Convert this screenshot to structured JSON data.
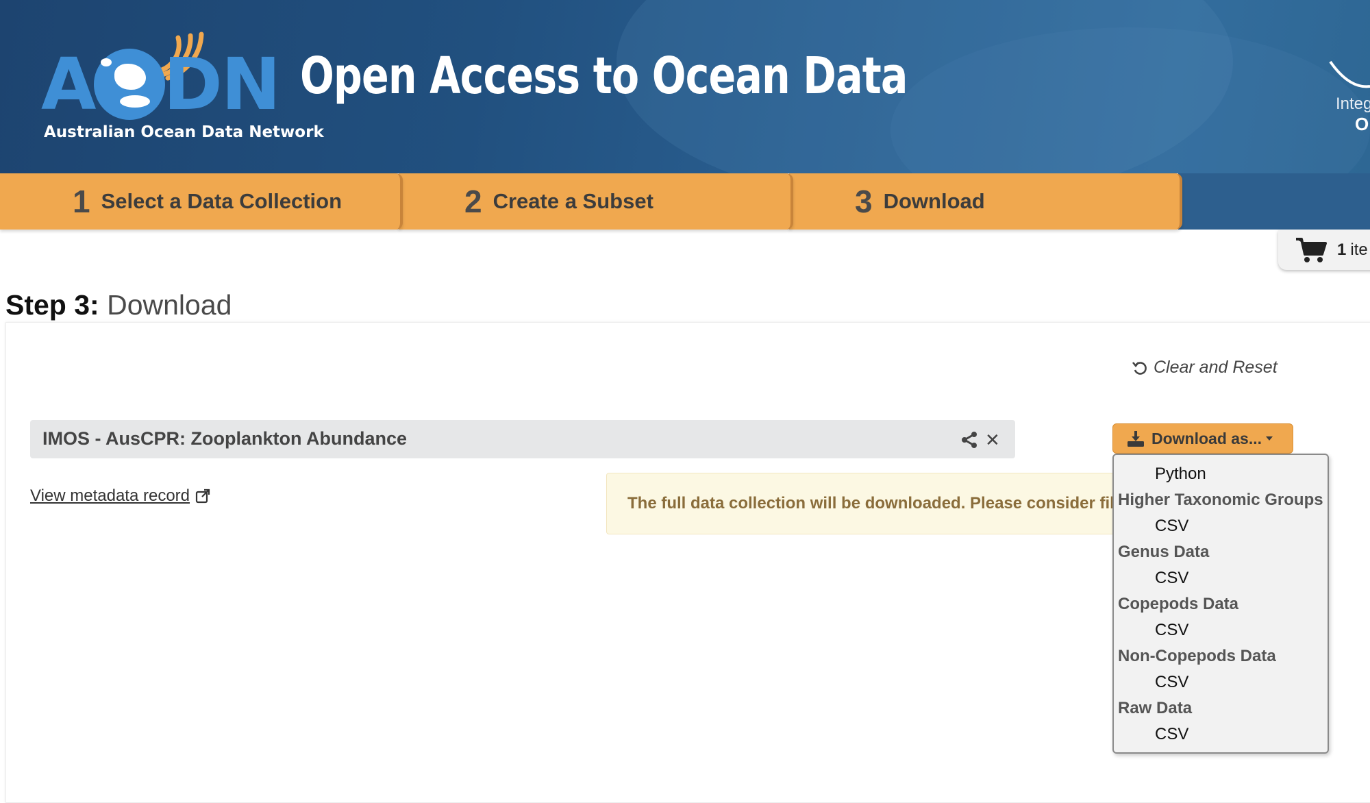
{
  "header": {
    "logo_letters": "AODN",
    "logo_subtitle": "Australian Ocean Data Network",
    "site_title": "Open Access to Ocean Data",
    "partner_text_line1": "Integ",
    "partner_text_line2": "O"
  },
  "steps": [
    {
      "number": "1",
      "label": "Select a Data Collection"
    },
    {
      "number": "2",
      "label": "Create a Subset"
    },
    {
      "number": "3",
      "label": "Download"
    }
  ],
  "cart": {
    "count": "1",
    "label": "ite"
  },
  "page_title": {
    "step": "Step 3:",
    "name": "Download"
  },
  "reset_label": "Clear and Reset",
  "collection": {
    "title": "IMOS - AusCPR: Zooplankton Abundance",
    "metadata_link": "View metadata record"
  },
  "notice": "The full data collection will be downloaded. Please consider fil",
  "download_button": "Download as...",
  "download_menu": {
    "python": "Python",
    "groups": [
      {
        "name": "Higher Taxonomic Groups",
        "option": "CSV"
      },
      {
        "name": "Genus Data",
        "option": "CSV"
      },
      {
        "name": "Copepods Data",
        "option": "CSV"
      },
      {
        "name": "Non-Copepods Data",
        "option": "CSV"
      },
      {
        "name": "Raw Data",
        "option": "CSV"
      }
    ]
  },
  "colors": {
    "header_blue": "#21507f",
    "step_orange": "#f0a84f",
    "logo_blue": "#3f8fd6",
    "notice_bg": "#fcf8e3",
    "notice_text": "#8a6d3b"
  }
}
